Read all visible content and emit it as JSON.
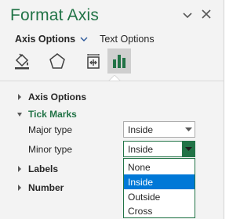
{
  "pane": {
    "title": "Format Axis",
    "close_icon": "close-icon",
    "menu_icon": "chevron-down-icon"
  },
  "subtabs": {
    "active": "Axis Options",
    "other": "Text Options"
  },
  "icon_tabs": [
    {
      "name": "fill-line-icon"
    },
    {
      "name": "effects-icon"
    },
    {
      "name": "size-properties-icon"
    },
    {
      "name": "axis-options-icon",
      "active": true
    }
  ],
  "sections": {
    "axis_options": "Axis Options",
    "tick_marks": "Tick Marks",
    "labels": "Labels",
    "number": "Number"
  },
  "tick_marks": {
    "major_label": "Major type",
    "major_value": "Inside",
    "minor_label": "Minor type",
    "minor_value": "Inside"
  },
  "dropdown": {
    "options": [
      "None",
      "Inside",
      "Outside",
      "Cross"
    ],
    "selected": "Inside"
  },
  "colors": {
    "accent": "#217346",
    "selection": "#0078d7",
    "pane_bg": "#f3f3f3"
  }
}
